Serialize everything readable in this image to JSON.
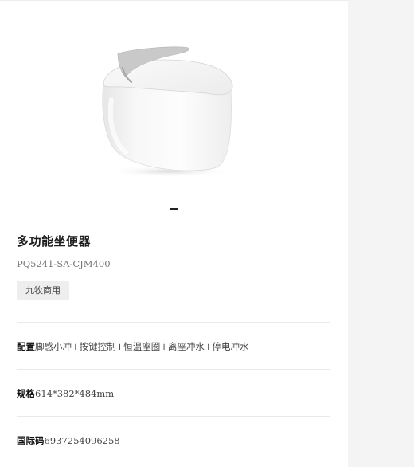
{
  "product": {
    "title": "多功能坐便器",
    "model": "PQ5241-SA-CJM400",
    "tag": "九牧商用",
    "image_icon": "smart-toilet-illustration"
  },
  "specs": [
    {
      "label": "配置",
      "value": "脚感小冲+按键控制+恒温座圈+离座冲水+停电冲水"
    },
    {
      "label": "规格",
      "value": "614*382*484mm"
    },
    {
      "label": "国际码",
      "value": "6937254096258"
    }
  ],
  "colors": {
    "panel": "#f4f4f4",
    "tag_bg": "#eeeeee",
    "divider": "#e9e9e9"
  }
}
